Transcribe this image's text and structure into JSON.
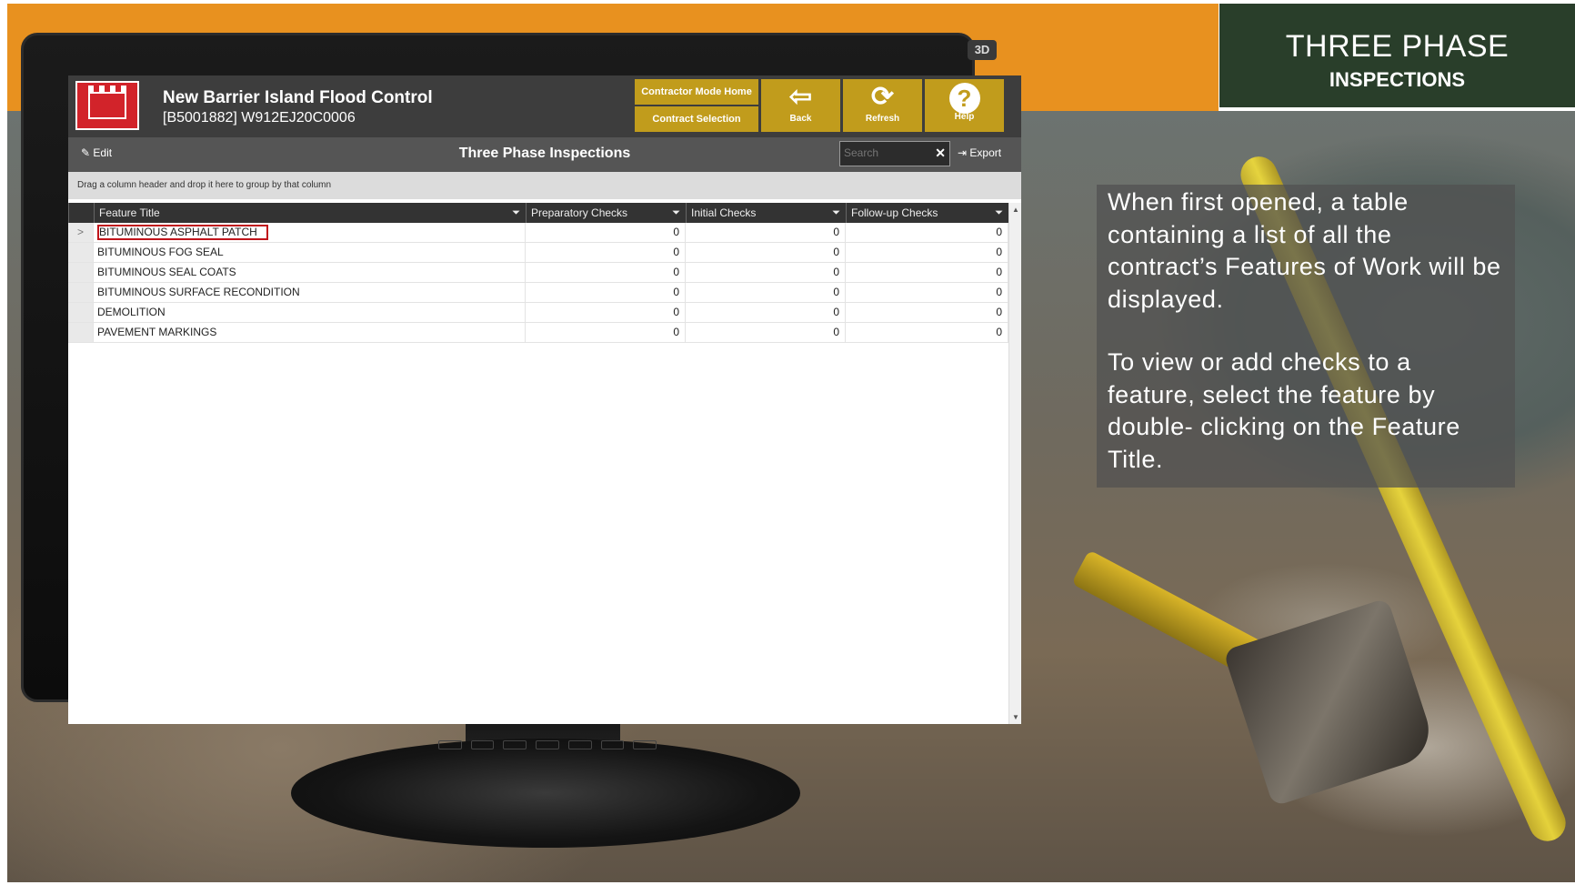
{
  "slide": {
    "title_main": "THREE PHASE",
    "title_sub": "INSPECTIONS",
    "info_paragraphs": [
      "When first opened, a table containing a list of all the contract’s Features of Work will be displayed.",
      "To view or add checks to a feature, select the feature by double- clicking on the Feature Title."
    ],
    "monitor_badge": "3D"
  },
  "app": {
    "project_name": "New Barrier Island Flood Control",
    "project_code": "[B5001882] W912EJ20C0006",
    "buttons": {
      "contractor_home": "Contractor Mode Home",
      "contract_selection": "Contract Selection",
      "back": "Back",
      "refresh": "Refresh",
      "help": "Help"
    },
    "toolbar": {
      "edit": "Edit",
      "title": "Three Phase Inspections",
      "search_placeholder": "Search",
      "export": "Export"
    },
    "group_hint": "Drag a column header and drop it here to group by that column",
    "columns": [
      "Feature Title",
      "Preparatory Checks",
      "Initial Checks",
      "Follow-up Checks"
    ],
    "rows": [
      {
        "title": "BITUMINOUS ASPHALT PATCH",
        "prep": "0",
        "initial": "0",
        "followup": "0",
        "selected": true
      },
      {
        "title": "BITUMINOUS FOG SEAL",
        "prep": "0",
        "initial": "0",
        "followup": "0"
      },
      {
        "title": "BITUMINOUS SEAL COATS",
        "prep": "0",
        "initial": "0",
        "followup": "0"
      },
      {
        "title": "BITUMINOUS SURFACE RECONDITION",
        "prep": "0",
        "initial": "0",
        "followup": "0"
      },
      {
        "title": "DEMOLITION",
        "prep": "0",
        "initial": "0",
        "followup": "0"
      },
      {
        "title": "PAVEMENT MARKINGS",
        "prep": "0",
        "initial": "0",
        "followup": "0"
      }
    ],
    "row_indicator": ">"
  },
  "colors": {
    "orange_band": "#e8911f",
    "title_box": "#293e2a",
    "gold_button": "#c19c1c",
    "logo_red": "#d2232a",
    "highlight_red": "#c0141b"
  },
  "icons": [
    "back-arrow-icon",
    "refresh-icon",
    "help-icon",
    "edit-icon",
    "export-icon",
    "filter-icon",
    "close-icon"
  ]
}
